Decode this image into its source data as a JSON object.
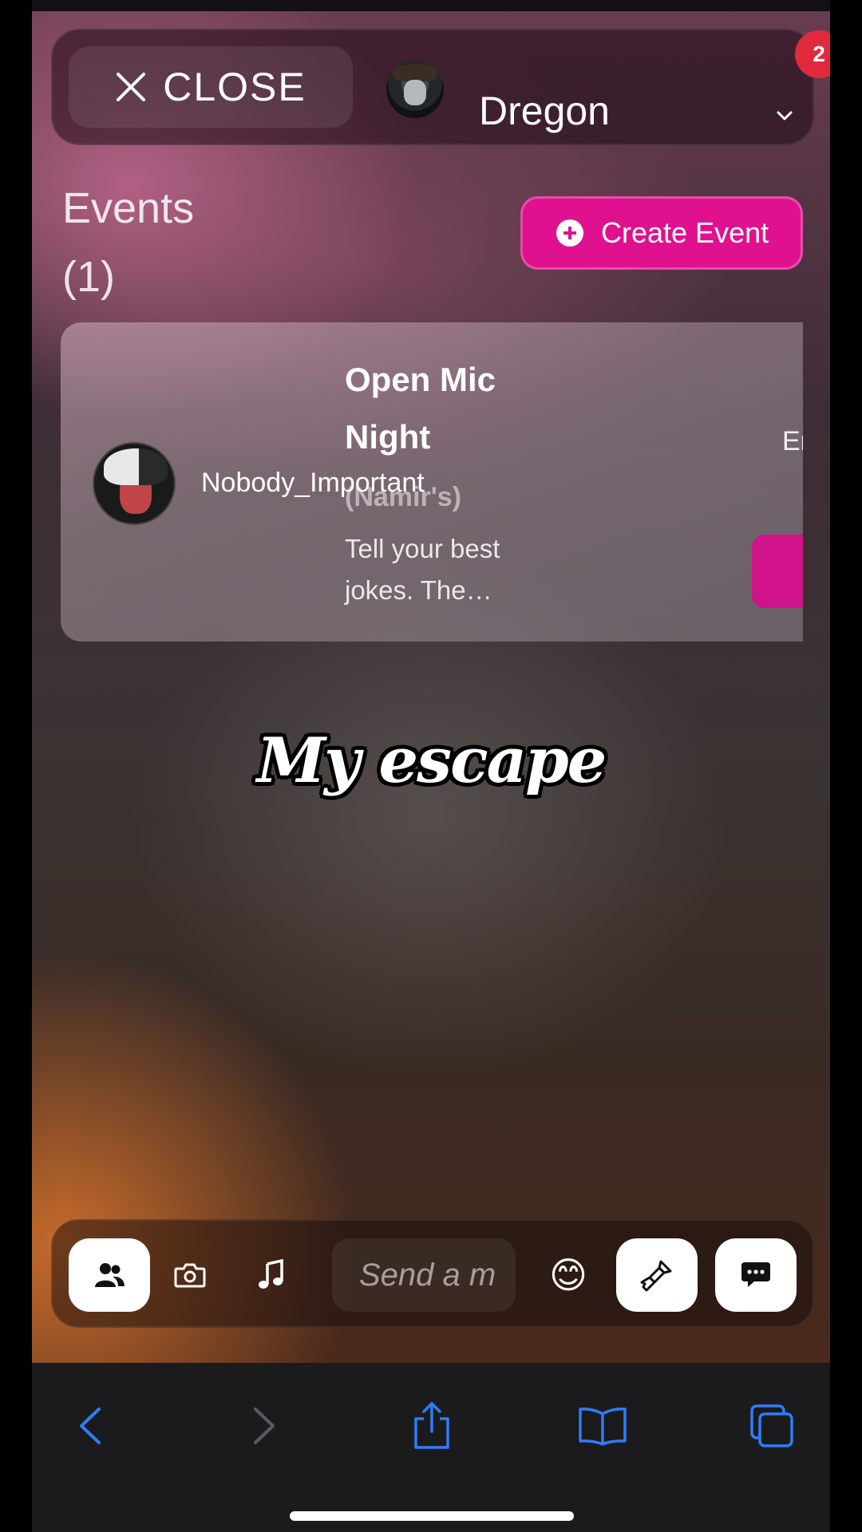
{
  "header": {
    "close_label": "CLOSE",
    "user_name": "Dregon",
    "notification_count": "2"
  },
  "events": {
    "title": "Events",
    "count": "(1)",
    "create_label": "Create Event"
  },
  "event_card": {
    "host_name": "Nobody_Important",
    "title": "Open Mic Night",
    "subtitle": "(Namir's)",
    "description": "Tell your best jokes. The…",
    "end_label": "End"
  },
  "caption": "My escape",
  "chat_bar": {
    "placeholder": "Send a m",
    "emoji": "😊"
  },
  "icons": [
    "close-icon",
    "chevron-down-icon",
    "plus-circle-icon",
    "users-icon",
    "camera-icon",
    "music-note-icon",
    "emoji-icon",
    "paint-brush-icon",
    "chat-bubble-icon",
    "back-icon",
    "forward-icon",
    "share-icon",
    "bookmarks-icon",
    "tabs-icon"
  ],
  "colors": {
    "accent": "#e0118f",
    "badge": "#e02a3c",
    "safari_blue": "#2f7cf6"
  }
}
